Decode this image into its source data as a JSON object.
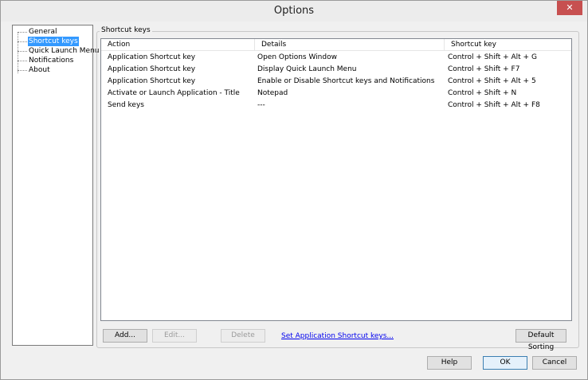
{
  "window": {
    "title": "Options",
    "close_glyph": "✕"
  },
  "tree": {
    "items": [
      {
        "label": "General",
        "selected": false
      },
      {
        "label": "Shortcut keys",
        "selected": true
      },
      {
        "label": "Quick Launch Menu",
        "selected": false
      },
      {
        "label": "Notifications",
        "selected": false
      },
      {
        "label": "About",
        "selected": false
      }
    ]
  },
  "group": {
    "label": "Shortcut keys"
  },
  "list": {
    "columns": [
      "Action",
      "Details",
      "Shortcut key"
    ],
    "rows": [
      [
        "Application Shortcut key",
        "Open Options Window",
        "Control + Shift + Alt + G"
      ],
      [
        "Application Shortcut key",
        "Display Quick Launch Menu",
        "Control + Shift + F7"
      ],
      [
        "Application Shortcut key",
        "Enable or Disable Shortcut keys and Notifications",
        "Control + Shift + Alt + 5"
      ],
      [
        "Activate or Launch Application - Title",
        "Notepad",
        "Control + Shift + N"
      ],
      [
        "Send keys",
        "---",
        "Control + Shift + Alt + F8"
      ]
    ]
  },
  "actions": {
    "add": "Add...",
    "edit": "Edit...",
    "delete": "Delete",
    "set_link": "Set Application Shortcut keys...",
    "default_sorting": "Default Sorting"
  },
  "dialog": {
    "help": "Help",
    "ok": "OK",
    "cancel": "Cancel"
  }
}
